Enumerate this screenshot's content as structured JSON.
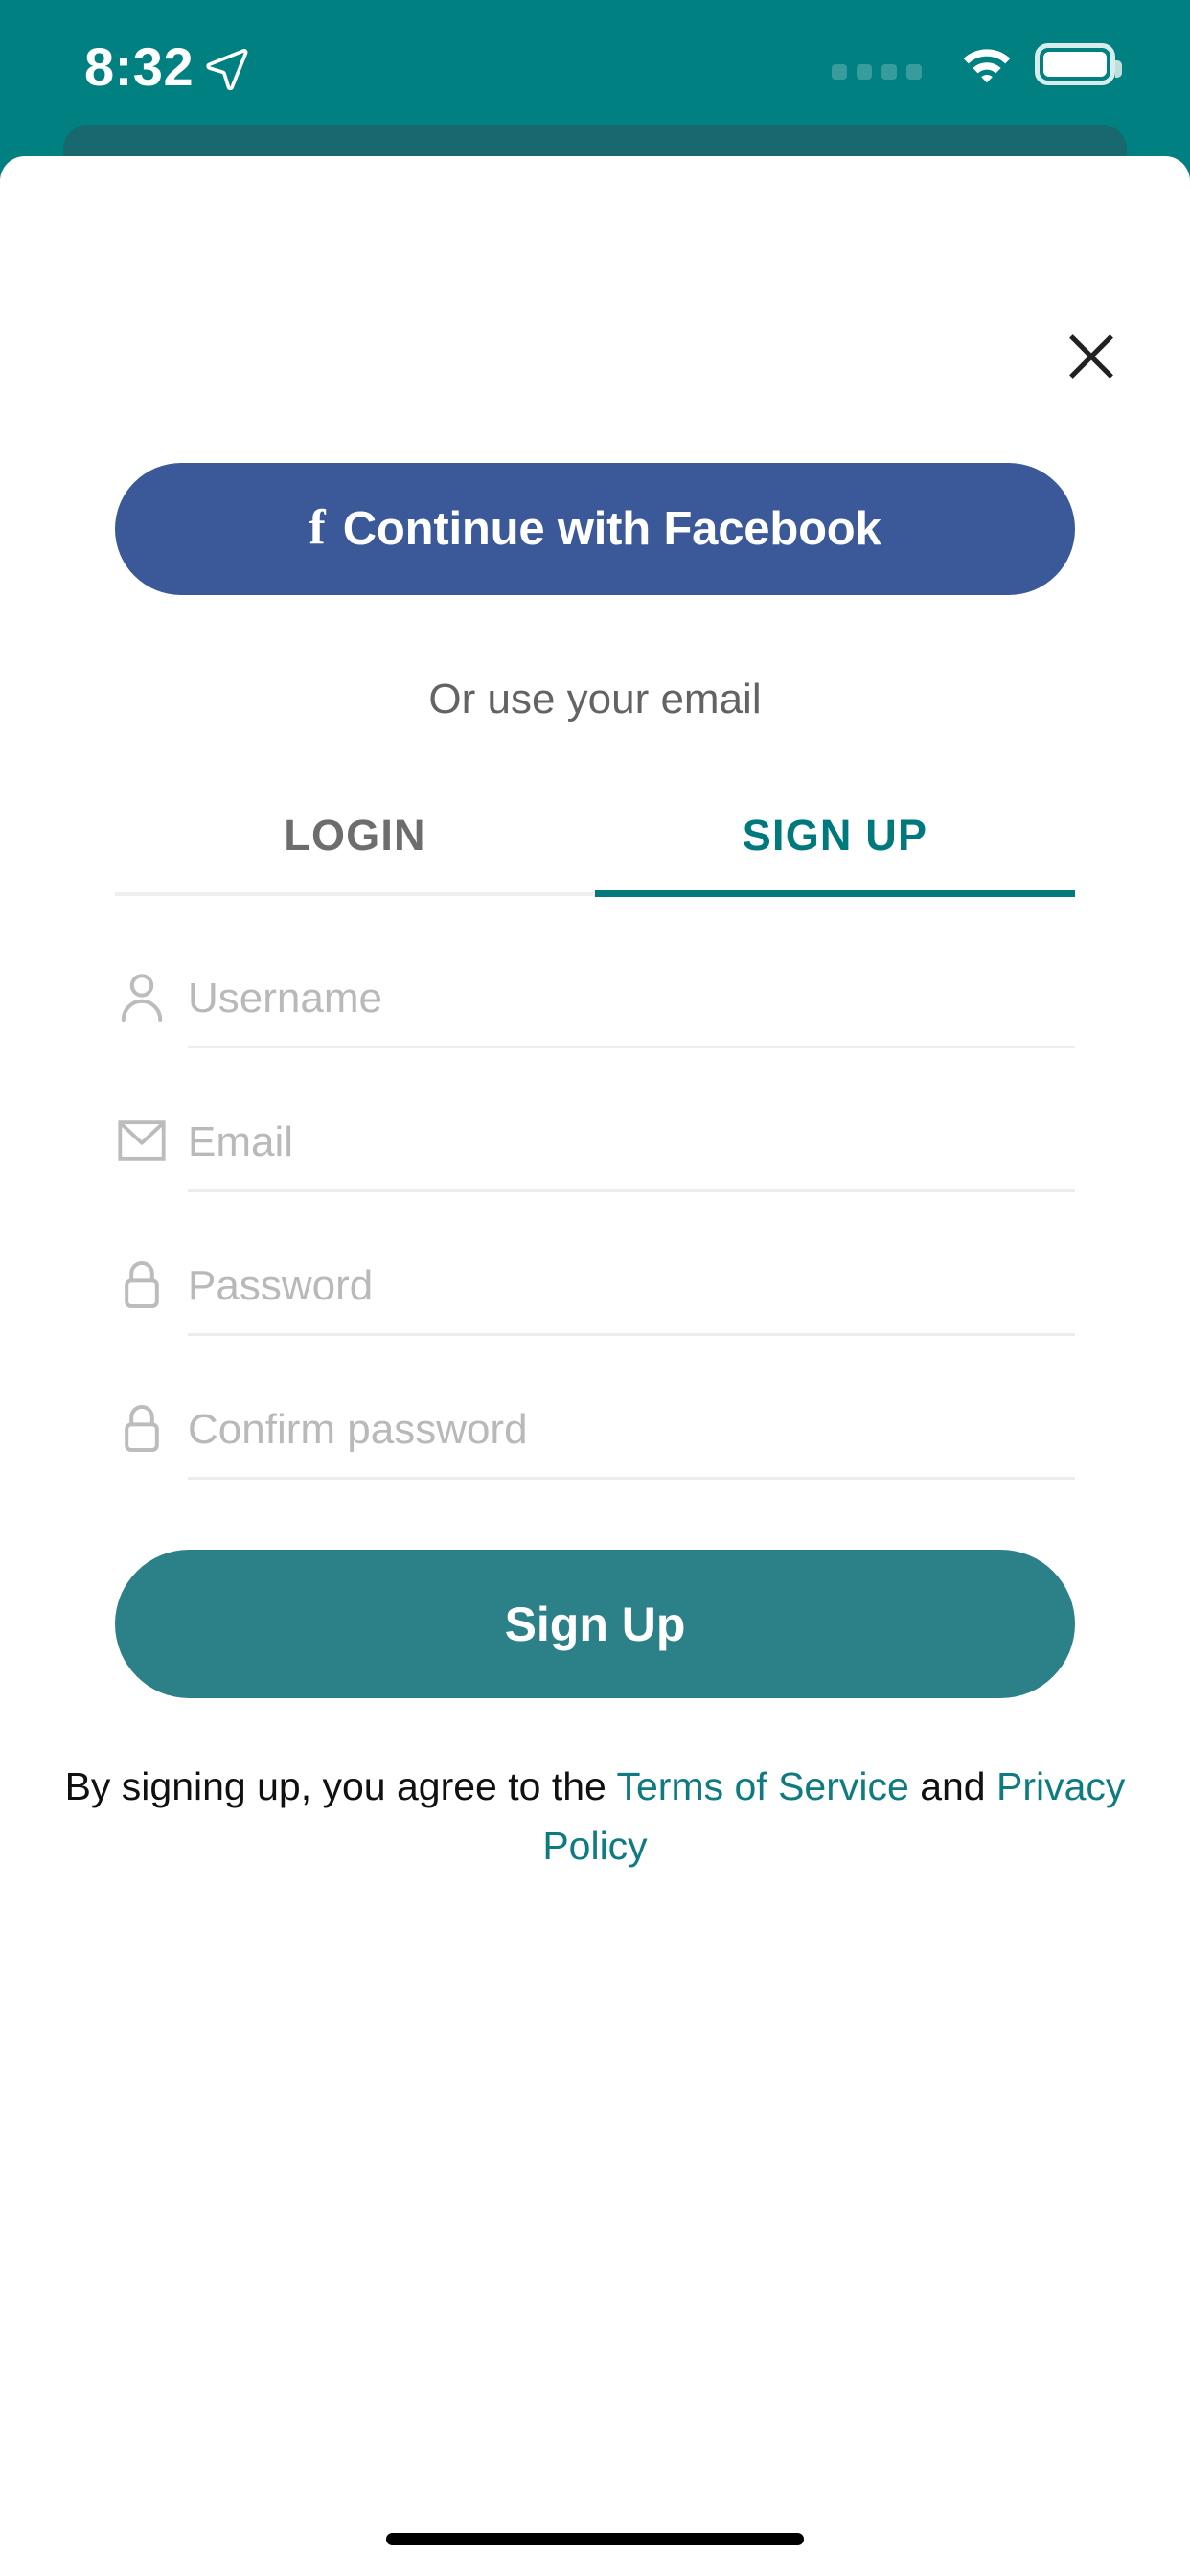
{
  "status_bar": {
    "time": "8:32",
    "location_icon": "location-arrow-icon",
    "signal_icon": "signal-dots-icon",
    "wifi_icon": "wifi-icon",
    "battery_icon": "battery-full-icon",
    "background_color": "#008080",
    "foreground_color": "#ffffff"
  },
  "sheet": {
    "close_icon": "close-icon",
    "background_color": "#ffffff"
  },
  "social": {
    "facebook_icon": "facebook-f-icon",
    "facebook_label": "Continue with Facebook",
    "facebook_color": "#3b5998"
  },
  "divider": {
    "text": "Or use your email"
  },
  "tabs": {
    "active": "SIGN UP",
    "accent_color": "#00797d",
    "items": [
      {
        "label": "LOGIN",
        "active": false
      },
      {
        "label": "SIGN UP",
        "active": true
      }
    ]
  },
  "form": {
    "fields": [
      {
        "name": "username",
        "icon": "user-icon",
        "placeholder": "Username",
        "value": ""
      },
      {
        "name": "email",
        "icon": "envelope-icon",
        "placeholder": "Email",
        "value": ""
      },
      {
        "name": "password",
        "icon": "lock-icon",
        "placeholder": "Password",
        "value": ""
      },
      {
        "name": "confirm_password",
        "icon": "lock-icon",
        "placeholder": "Confirm password",
        "value": ""
      }
    ]
  },
  "submit": {
    "label": "Sign Up",
    "color": "#2b8187"
  },
  "terms": {
    "prefix": "By signing up, you agree to the ",
    "terms_link": "Terms of Service",
    "middle": " and ",
    "privacy_link": "Privacy Policy",
    "link_color": "#0d7b80"
  },
  "system": {
    "home_indicator": "home-indicator"
  }
}
